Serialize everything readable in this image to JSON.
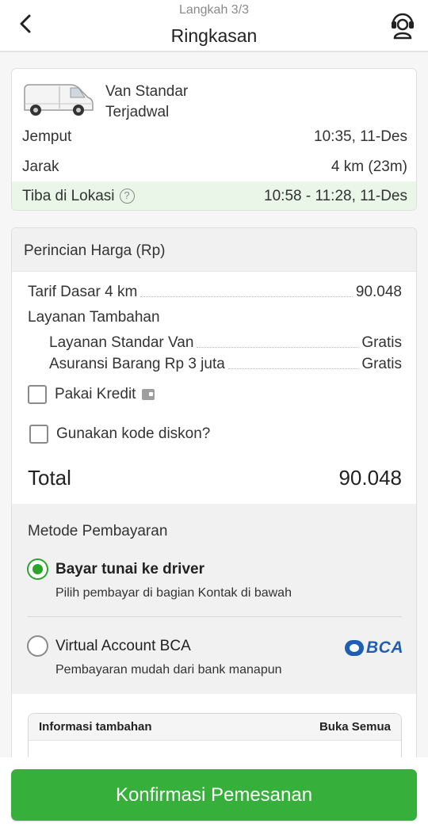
{
  "header": {
    "step": "Langkah 3/3",
    "title": "Ringkasan",
    "back_icon": "chevron-left-icon",
    "support_icon": "headset-icon"
  },
  "vehicle": {
    "name": "Van Standar",
    "schedule_type": "Terjadwal",
    "image_icon": "van-icon",
    "pickup_label": "Jemput",
    "pickup_value": "10:35, 11-Des",
    "distance_label": "Jarak",
    "distance_value": "4 km (23m)",
    "arrival_label": "Tiba di Lokasi",
    "arrival_value": "10:58 - 11:28, 11-Des"
  },
  "price": {
    "header": "Perincian Harga (Rp)",
    "base_fare_label": "Tarif Dasar 4 km",
    "base_fare_value": "90.048",
    "extra_services_title": "Layanan Tambahan",
    "services": [
      {
        "label": "Layanan Standar Van",
        "value": "Gratis"
      },
      {
        "label": "Asuransi Barang Rp 3 juta",
        "value": "Gratis"
      }
    ],
    "use_credit_label": "Pakai Kredit",
    "discount_label": "Gunakan kode diskon?",
    "total_label": "Total",
    "total_value": "90.048"
  },
  "payment": {
    "title": "Metode Pembayaran",
    "options": [
      {
        "label": "Bayar tunai ke driver",
        "description": "Pilih pembayar di bagian Kontak di bawah",
        "selected": true
      },
      {
        "label": "Virtual Account BCA",
        "description": "Pembayaran mudah dari bank manapun",
        "selected": false,
        "logo_text": "BCA"
      }
    ]
  },
  "extra_info": {
    "title": "Informasi tambahan",
    "expand_label": "Buka Semua"
  },
  "confirm_button": "Konfirmasi Pemesanan",
  "colors": {
    "accent_green": "#36b03a",
    "highlight_green_bg": "#e9f6e8",
    "bca_blue": "#1f5fb3"
  }
}
